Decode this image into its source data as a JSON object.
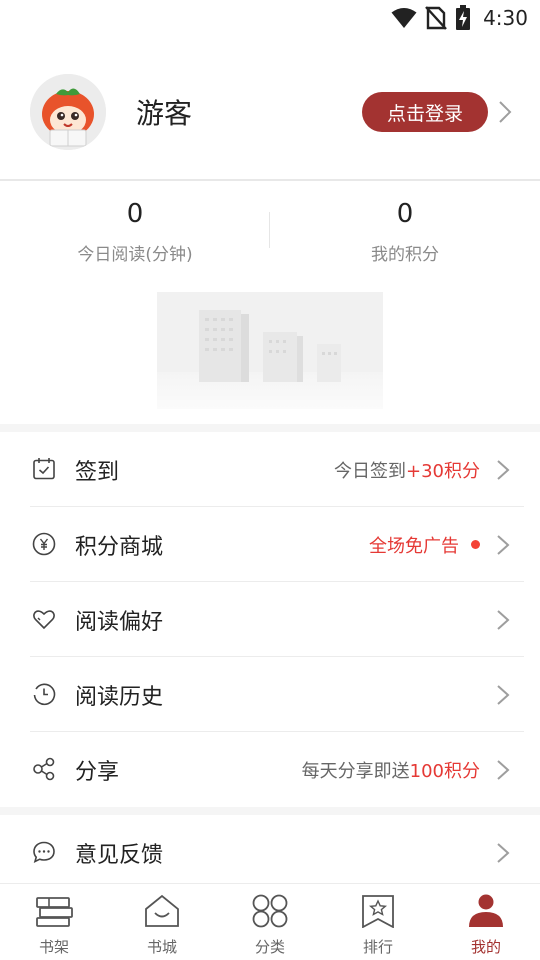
{
  "status_bar": {
    "time": "4:30"
  },
  "profile": {
    "username": "游客",
    "login_label": "点击登录"
  },
  "stats": [
    {
      "value": "0",
      "label": "今日阅读(分钟)"
    },
    {
      "value": "0",
      "label": "我的积分"
    }
  ],
  "menu": {
    "sign_in": {
      "label": "签到",
      "right_text": "今日签到",
      "right_highlight": "+30积分"
    },
    "points_mall": {
      "label": "积分商城",
      "right_highlight": "全场免广告"
    },
    "preferences": {
      "label": "阅读偏好"
    },
    "history": {
      "label": "阅读历史"
    },
    "share": {
      "label": "分享",
      "right_text": "每天分享即送",
      "right_highlight": "100积分"
    },
    "feedback": {
      "label": "意见反馈"
    }
  },
  "bottom_nav": {
    "bookshelf": "书架",
    "bookstore": "书城",
    "category": "分类",
    "ranking": "排行",
    "mine": "我的"
  },
  "colors": {
    "accent": "#a33331",
    "highlight": "#e53935"
  }
}
